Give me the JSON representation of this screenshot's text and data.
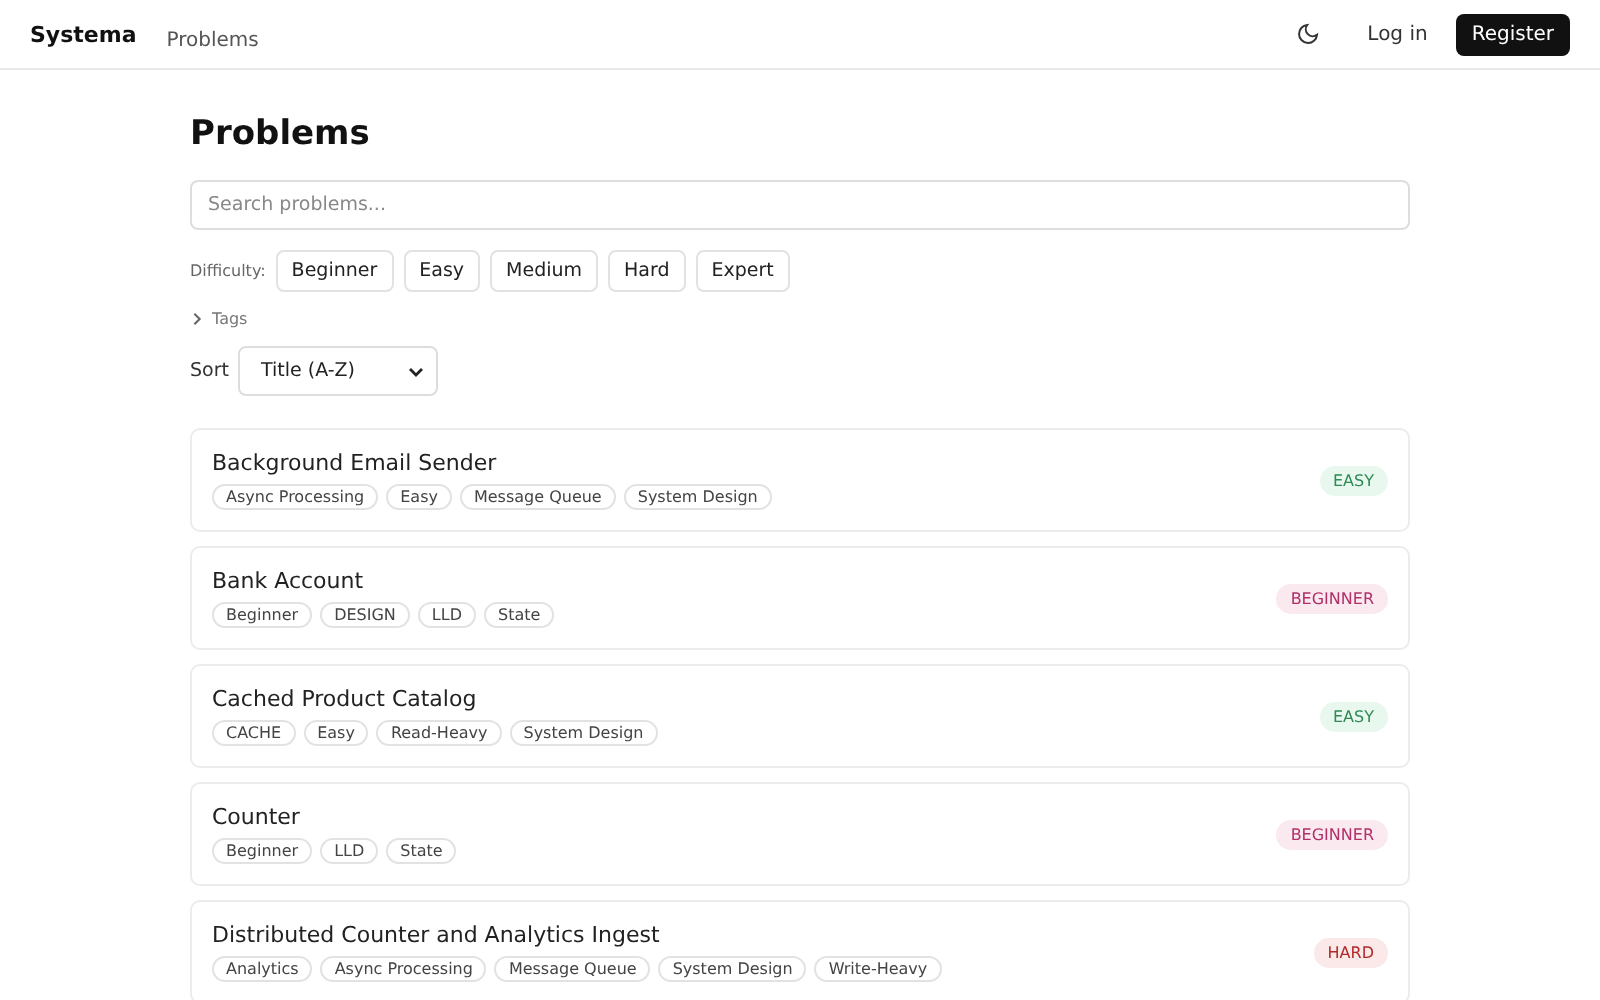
{
  "nav": {
    "brand": "Systema",
    "links": [
      {
        "label": "Problems"
      }
    ],
    "login": "Log in",
    "register": "Register"
  },
  "page": {
    "title": "Problems",
    "search": {
      "placeholder": "Search problems..."
    },
    "difficulty": {
      "label": "Difficulty:",
      "options": [
        {
          "label": "Beginner",
          "selected": false
        },
        {
          "label": "Easy",
          "selected": false
        },
        {
          "label": "Medium",
          "selected": false
        },
        {
          "label": "Hard",
          "selected": false
        },
        {
          "label": "Expert",
          "selected": false
        }
      ]
    },
    "tags_toggle": {
      "label": "Tags",
      "expanded": false
    },
    "sort": {
      "label": "Sort",
      "value": "Title (A-Z)"
    }
  },
  "problems": [
    {
      "title": "Background Email Sender",
      "tags": [
        "Async Processing",
        "Easy",
        "Message Queue",
        "System Design"
      ],
      "badge": "EASY",
      "kind": "easy"
    },
    {
      "title": "Bank Account",
      "tags": [
        "Beginner",
        "DESIGN",
        "LLD",
        "State"
      ],
      "badge": "BEGINNER",
      "kind": "beginner"
    },
    {
      "title": "Cached Product Catalog",
      "tags": [
        "CACHE",
        "Easy",
        "Read-Heavy",
        "System Design"
      ],
      "badge": "EASY",
      "kind": "easy"
    },
    {
      "title": "Counter",
      "tags": [
        "Beginner",
        "LLD",
        "State"
      ],
      "badge": "BEGINNER",
      "kind": "beginner"
    },
    {
      "title": "Distributed Counter and Analytics Ingest",
      "tags": [
        "Analytics",
        "Async Processing",
        "Message Queue",
        "System Design",
        "Write-Heavy"
      ],
      "badge": "HARD",
      "kind": "hard"
    }
  ]
}
